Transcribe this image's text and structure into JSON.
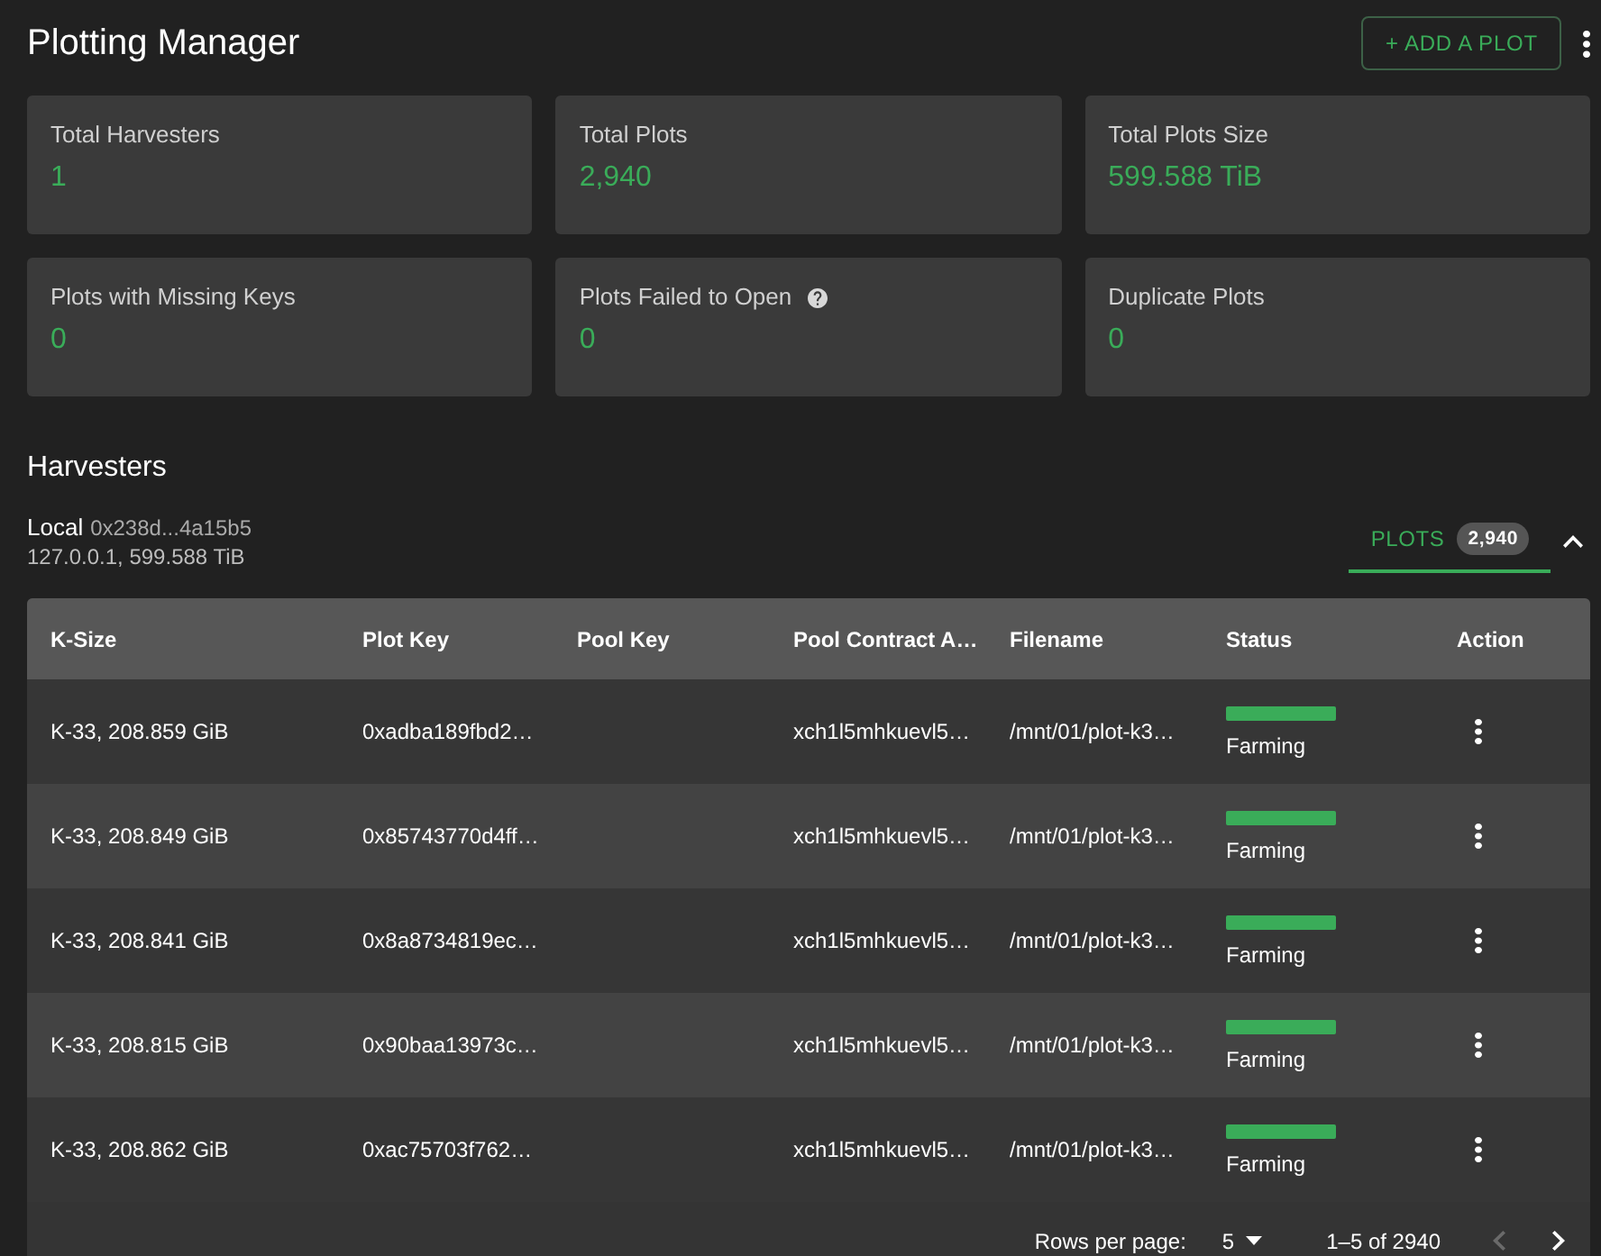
{
  "header": {
    "title": "Plotting Manager",
    "add_button": "+ ADD A PLOT"
  },
  "stats": [
    {
      "label": "Total Harvesters",
      "value": "1",
      "help": false
    },
    {
      "label": "Total Plots",
      "value": "2,940",
      "help": false
    },
    {
      "label": "Total Plots Size",
      "value": "599.588 TiB",
      "help": false
    },
    {
      "label": "Plots with Missing Keys",
      "value": "0",
      "help": false
    },
    {
      "label": "Plots Failed to Open",
      "value": "0",
      "help": true
    },
    {
      "label": "Duplicate Plots",
      "value": "0",
      "help": false
    }
  ],
  "harvesters": {
    "title": "Harvesters",
    "items": [
      {
        "name": "Local",
        "id": "0x238d...4a15b5",
        "details": "127.0.0.1, 599.588 TiB",
        "expanded": true,
        "tabs": [
          {
            "label": "PLOTS",
            "count": "2,940",
            "selected": true
          }
        ],
        "table": {
          "columns": [
            "K-Size",
            "Plot Key",
            "Pool Key",
            "Pool Contract A…",
            "Filename",
            "Status",
            "Action"
          ],
          "rows": [
            {
              "k_size": "K-33, 208.859 GiB",
              "plot_key": "0xadba189fbd2…",
              "pool_contract": "xch1l5mhkuevl5…",
              "filename": "/mnt/01/plot-k3…",
              "status": "Farming",
              "color": "#3aac59"
            },
            {
              "k_size": "K-33, 208.849 GiB",
              "plot_key": "0x85743770d4ff…",
              "pool_contract": "xch1l5mhkuevl5…",
              "filename": "/mnt/01/plot-k3…",
              "status": "Farming",
              "color": "#3aac59"
            },
            {
              "k_size": "K-33, 208.841 GiB",
              "plot_key": "0x8a8734819ec…",
              "pool_contract": "xch1l5mhkuevl5…",
              "filename": "/mnt/01/plot-k3…",
              "status": "Farming",
              "color": "#3aac59"
            },
            {
              "k_size": "K-33, 208.815 GiB",
              "plot_key": "0x90baa13973c…",
              "pool_contract": "xch1l5mhkuevl5…",
              "filename": "/mnt/01/plot-k3…",
              "status": "Farming",
              "color": "#3aac59"
            },
            {
              "k_size": "K-33, 208.862 GiB",
              "plot_key": "0xac75703f762…",
              "pool_contract": "xch1l5mhkuevl5…",
              "filename": "/mnt/01/plot-k3…",
              "status": "Farming",
              "color": "#3aac59"
            }
          ]
        },
        "pagination": {
          "rows_per_page_label": "Rows per page:",
          "rows_per_page": "5",
          "range": "1–5 of 2940",
          "previous_disabled": true,
          "next_disabled": false
        }
      }
    ]
  }
}
